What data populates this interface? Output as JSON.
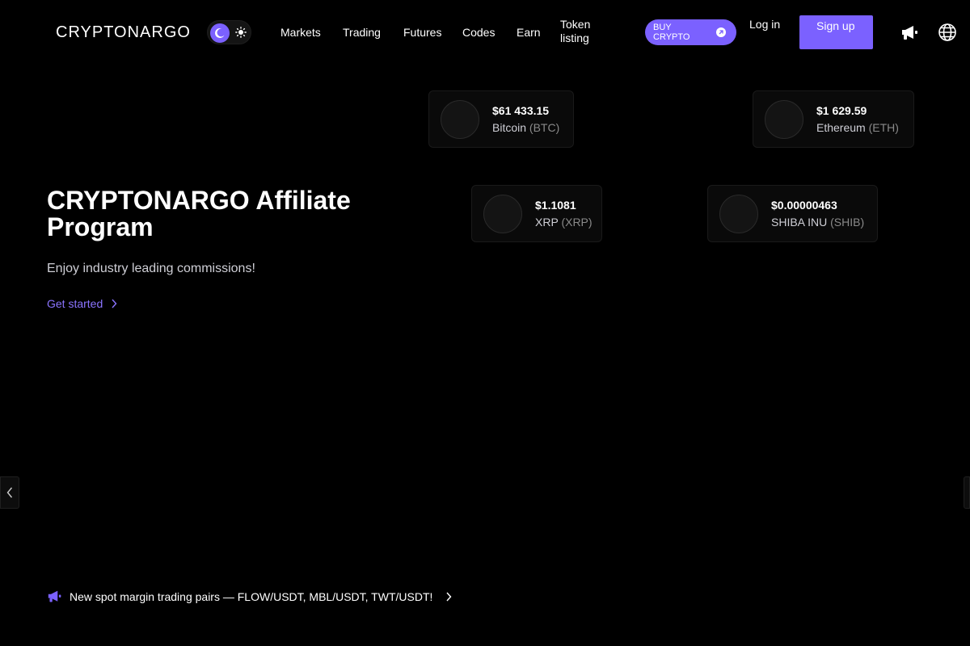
{
  "header": {
    "logo": "CRYPTONARGO",
    "nav": [
      "Markets",
      "Trading",
      "Futures",
      "Codes",
      "Earn"
    ],
    "token_listing": "Token listing",
    "buy_crypto": "BUY CRYPTO",
    "login": "Log in",
    "signup": "Sign up"
  },
  "hero": {
    "title": "CRYPTONARGO Affiliate Program",
    "subtitle": "Enjoy industry leading commissions!",
    "cta": "Get started"
  },
  "coins": [
    {
      "price": "$61 433.15",
      "name": "Bitcoin",
      "symbol": "(BTC)"
    },
    {
      "price": "$1 629.59",
      "name": "Ethereum",
      "symbol": "(ETH)"
    },
    {
      "price": "$1.1081",
      "name": "XRP",
      "symbol": "(XRP)"
    },
    {
      "price": "$0.00000463",
      "name": "SHIBA INU",
      "symbol": "(SHIB)"
    }
  ],
  "announcement": "New spot margin trading pairs — FLOW/USDT, MBL/USDT, TWT/USDT!",
  "colors": {
    "accent": "#7b61ff",
    "background": "#000000"
  },
  "icons": [
    "moon-icon",
    "sun-icon",
    "megaphone-icon",
    "globe-icon",
    "chevron-right-icon",
    "chevron-left-icon"
  ]
}
